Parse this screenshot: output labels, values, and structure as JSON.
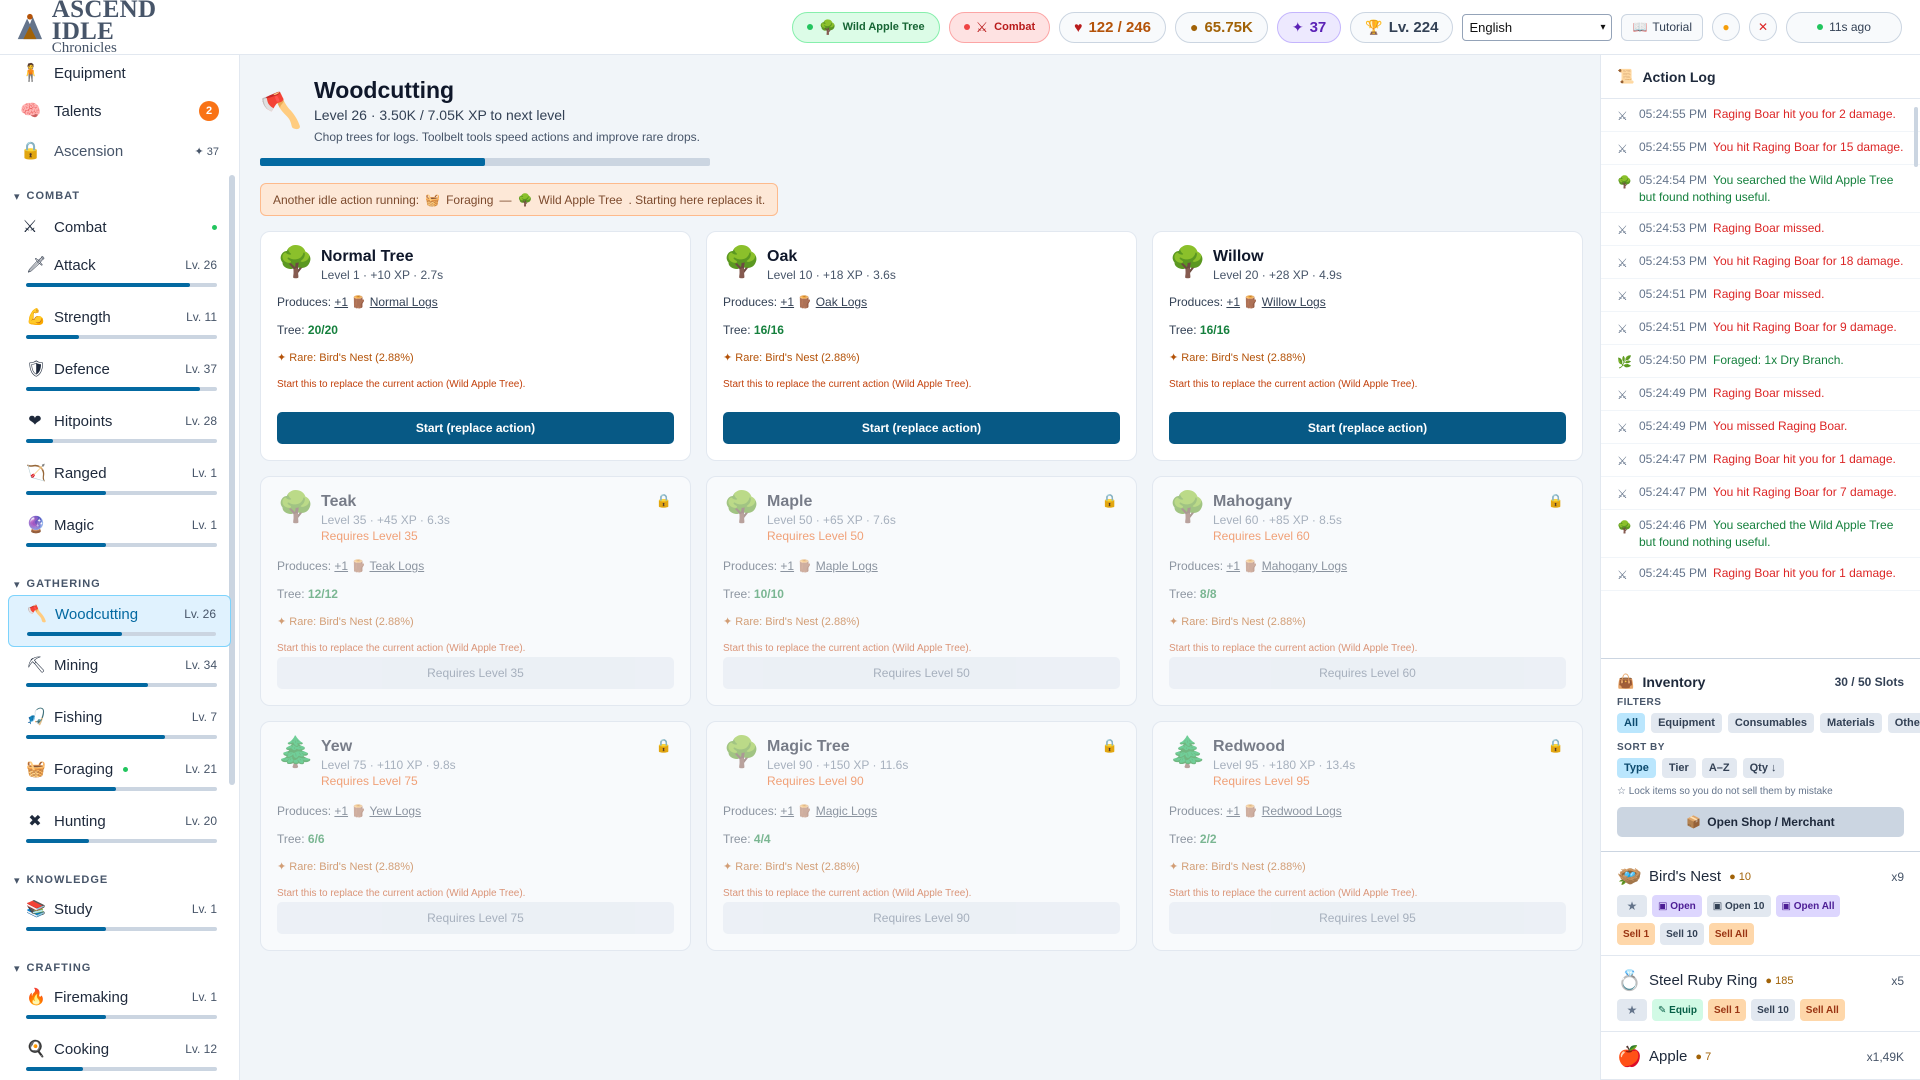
{
  "header": {
    "logo_title": "ASCEND IDLE",
    "logo_sub": "Chronicles",
    "activity_pill": "Wild Apple Tree",
    "combat_pill": "Combat",
    "hitpoints": "122 / 246",
    "gold": "65.75K",
    "ascension_points": "37",
    "total_level": "Lv. 224",
    "language": "English",
    "tutorial": "Tutorial",
    "sync": "11s ago"
  },
  "sidebar": {
    "top": [
      {
        "label": "Equipment"
      },
      {
        "label": "Talents",
        "badge": "2"
      },
      {
        "label": "Ascension",
        "badge": "37"
      }
    ],
    "sections": {
      "combat": "COMBAT",
      "gathering": "GATHERING",
      "knowledge": "KNOWLEDGE",
      "crafting": "CRAFTING"
    },
    "combat_item": "Combat",
    "combat_skills": [
      {
        "name": "Attack",
        "level": "Lv. 26",
        "progress": 0.86
      },
      {
        "name": "Strength",
        "level": "Lv. 11",
        "progress": 0.28
      },
      {
        "name": "Defence",
        "level": "Lv. 37",
        "progress": 0.91
      },
      {
        "name": "Hitpoints",
        "level": "Lv. 28",
        "progress": 0.14
      },
      {
        "name": "Ranged",
        "level": "Lv. 1",
        "progress": 0.42
      },
      {
        "name": "Magic",
        "level": "Lv. 1",
        "progress": 0.42
      }
    ],
    "gathering_skills": [
      {
        "name": "Woodcutting",
        "level": "Lv. 26",
        "progress": 0.5
      },
      {
        "name": "Mining",
        "level": "Lv. 34",
        "progress": 0.64
      },
      {
        "name": "Fishing",
        "level": "Lv. 7",
        "progress": 0.73
      },
      {
        "name": "Foraging",
        "level": "Lv. 21",
        "progress": 0.47
      },
      {
        "name": "Hunting",
        "level": "Lv. 20",
        "progress": 0.33
      }
    ],
    "knowledge_skills": [
      {
        "name": "Study",
        "level": "Lv. 1",
        "progress": 0.42
      }
    ],
    "crafting_skills": [
      {
        "name": "Firemaking",
        "level": "Lv. 1",
        "progress": 0.42
      },
      {
        "name": "Cooking",
        "level": "Lv. 12",
        "progress": 0.3
      }
    ]
  },
  "main": {
    "title": "Woodcutting",
    "subtitle": "Level 26 · 3.50K / 7.05K XP to next level",
    "description": "Chop trees for logs. Toolbelt tools speed actions and improve rare drops.",
    "progress": 0.5,
    "warning_prefix": "Another idle action running:",
    "warning_activity": "Foraging",
    "warning_dash": "—",
    "warning_target": "Wild Apple Tree",
    "warning_suffix": ". Starting here replaces it.",
    "produces_label": "Produces:",
    "tree_label": "Tree:",
    "rare_label": "Rare: Bird's Nest (2.88%)",
    "replace_note": "Start this to replace the current action (Wild Apple Tree).",
    "trees": [
      {
        "name": "Normal Tree",
        "meta": "Level 1 · +10 XP · 2.7s",
        "req": "",
        "logs": "+1",
        "log_name": "Normal Logs",
        "hp": "20/20",
        "button": "Start (replace action)",
        "locked": false
      },
      {
        "name": "Oak",
        "meta": "Level 10 · +18 XP · 3.6s",
        "req": "",
        "logs": "+1",
        "log_name": "Oak Logs",
        "hp": "16/16",
        "button": "Start (replace action)",
        "locked": false
      },
      {
        "name": "Willow",
        "meta": "Level 20 · +28 XP · 4.9s",
        "req": "",
        "logs": "+1",
        "log_name": "Willow Logs",
        "hp": "16/16",
        "button": "Start (replace action)",
        "locked": false
      },
      {
        "name": "Teak",
        "meta": "Level 35 · +45 XP · 6.3s",
        "req": "Requires Level 35",
        "logs": "+1",
        "log_name": "Teak Logs",
        "hp": "12/12",
        "button": "Requires Level 35",
        "locked": true
      },
      {
        "name": "Maple",
        "meta": "Level 50 · +65 XP · 7.6s",
        "req": "Requires Level 50",
        "logs": "+1",
        "log_name": "Maple Logs",
        "hp": "10/10",
        "button": "Requires Level 50",
        "locked": true
      },
      {
        "name": "Mahogany",
        "meta": "Level 60 · +85 XP · 8.5s",
        "req": "Requires Level 60",
        "logs": "+1",
        "log_name": "Mahogany Logs",
        "hp": "8/8",
        "button": "Requires Level 60",
        "locked": true
      },
      {
        "name": "Yew",
        "meta": "Level 75 · +110 XP · 9.8s",
        "req": "Requires Level 75",
        "logs": "+1",
        "log_name": "Yew Logs",
        "hp": "6/6",
        "button": "Requires Level 75",
        "locked": true
      },
      {
        "name": "Magic Tree",
        "meta": "Level 90 · +150 XP · 11.6s",
        "req": "Requires Level 90",
        "logs": "+1",
        "log_name": "Magic Logs",
        "hp": "4/4",
        "button": "Requires Level 90",
        "locked": true
      },
      {
        "name": "Redwood",
        "meta": "Level 95 · +180 XP · 13.4s",
        "req": "Requires Level 95",
        "logs": "+1",
        "log_name": "Redwood Logs",
        "hp": "2/2",
        "button": "Requires Level 95",
        "locked": true
      }
    ]
  },
  "action_log": {
    "title": "Action Log",
    "entries": [
      {
        "time": "05:24:55 PM",
        "text": "Raging Boar hit you for 2 damage.",
        "color": "red",
        "icon": "crossed-swords"
      },
      {
        "time": "05:24:55 PM",
        "text": "You hit Raging Boar for 15 damage.",
        "color": "red",
        "icon": "crossed-swords"
      },
      {
        "time": "05:24:54 PM",
        "text": "You searched the Wild Apple Tree but found nothing useful.",
        "color": "green",
        "icon": "tree"
      },
      {
        "time": "05:24:53 PM",
        "text": "Raging Boar missed.",
        "color": "red",
        "icon": "crossed-swords"
      },
      {
        "time": "05:24:53 PM",
        "text": "You hit Raging Boar for 18 damage.",
        "color": "red",
        "icon": "crossed-swords"
      },
      {
        "time": "05:24:51 PM",
        "text": "Raging Boar missed.",
        "color": "red",
        "icon": "crossed-swords"
      },
      {
        "time": "05:24:51 PM",
        "text": "You hit Raging Boar for 9 damage.",
        "color": "red",
        "icon": "crossed-swords"
      },
      {
        "time": "05:24:50 PM",
        "text": "Foraged: 1x Dry Branch.",
        "color": "green",
        "icon": "branch"
      },
      {
        "time": "05:24:49 PM",
        "text": "Raging Boar missed.",
        "color": "red",
        "icon": "crossed-swords"
      },
      {
        "time": "05:24:49 PM",
        "text": "You missed Raging Boar.",
        "color": "red",
        "icon": "crossed-swords"
      },
      {
        "time": "05:24:47 PM",
        "text": "Raging Boar hit you for 1 damage.",
        "color": "red",
        "icon": "crossed-swords"
      },
      {
        "time": "05:24:47 PM",
        "text": "You hit Raging Boar for 7 damage.",
        "color": "red",
        "icon": "crossed-swords"
      },
      {
        "time": "05:24:46 PM",
        "text": "You searched the Wild Apple Tree but found nothing useful.",
        "color": "green",
        "icon": "tree"
      },
      {
        "time": "05:24:45 PM",
        "text": "Raging Boar hit you for 1 damage.",
        "color": "red",
        "icon": "crossed-swords"
      }
    ]
  },
  "inventory": {
    "title": "Inventory",
    "slots": "30 / 50 Slots",
    "filters_label": "FILTERS",
    "filters": [
      "All",
      "Equipment",
      "Consumables",
      "Materials",
      "Other"
    ],
    "sort_label": "SORT BY",
    "sorts": [
      "Type",
      "Tier",
      "A–Z",
      "Qty ↓"
    ],
    "lock_hint": "☆ Lock items so you do not sell them by mistake",
    "shop_button": "Open Shop / Merchant",
    "items": [
      {
        "name": "Bird's Nest",
        "price": "10",
        "qty": "x9",
        "actions": [
          "Open",
          "Open 10",
          "Open All"
        ],
        "sells": [
          "Sell 1",
          "Sell 10",
          "Sell All"
        ]
      },
      {
        "name": "Steel Ruby Ring",
        "price": "185",
        "qty": "x5",
        "actions": [
          "Equip"
        ],
        "sells": [
          "Sell 1",
          "Sell 10",
          "Sell All"
        ]
      },
      {
        "name": "Apple",
        "price": "7",
        "qty": "x1,49K"
      }
    ]
  }
}
